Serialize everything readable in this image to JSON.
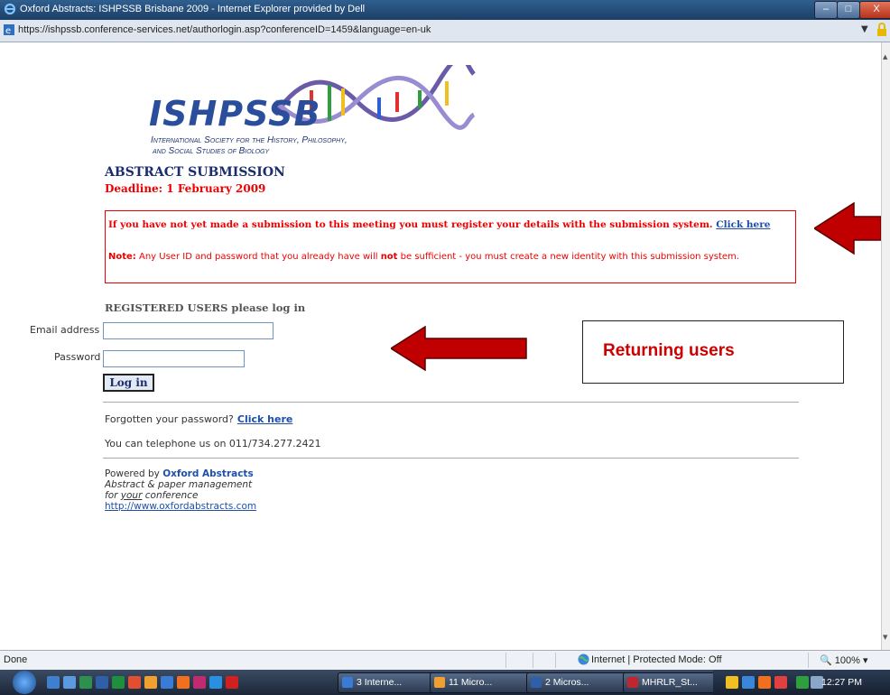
{
  "window": {
    "title": "Oxford Abstracts: ISHPSSB Brisbane 2009 - Internet Explorer provided by Dell",
    "minimize": "–",
    "maximize": "□",
    "close": "X"
  },
  "address_bar": {
    "url": "https://ishpssb.conference-services.net/authorlogin.asp?conferenceID=1459&language=en-uk",
    "dropdown": "▼"
  },
  "page": {
    "logo_text": "ISHPSSB",
    "logo_subtitle_line1": "International Society for the History, Philosophy,",
    "logo_subtitle_line2": "and Social Studies of Biology",
    "heading": "ABSTRACT SUBMISSION",
    "deadline": "Deadline: 1 February 2009",
    "notice": {
      "text": "If you have not yet made a submission to this meeting you must register your details with the submission system.",
      "link": "Click here",
      "note_label": "Note:",
      "note_pre": " Any User ID and password that you already have will ",
      "note_bold": "not",
      "note_post": " be sufficient - you must create a new identity with this submission system."
    },
    "login": {
      "heading": "REGISTERED USERS please log in",
      "email_label": "Email address",
      "email_value": "",
      "password_label": "Password",
      "password_value": "",
      "button": "Log in"
    },
    "forgot_text": "Forgotten your password?",
    "forgot_link": "Click here",
    "phone": "You can telephone us on 011/734.277.2421",
    "powered_by": "Powered by",
    "powered_brand": "Oxford Abstracts",
    "tagline1": "Abstract & paper management",
    "tagline2_pre": "for ",
    "tagline2_em": "your",
    "tagline2_post": " conference",
    "website": "http://www.oxfordabstracts.com"
  },
  "annotation": {
    "returning_label": "Returning users",
    "arrow_color": "#c00000"
  },
  "status_bar": {
    "status": "Done",
    "zone": "Internet | Protected Mode: Off",
    "zoom": "100%"
  },
  "taskbar": {
    "tasks": [
      {
        "label": "3 Interne...",
        "color": "#3a7bd5"
      },
      {
        "label": "11 Micro...",
        "color": "#f0a030"
      },
      {
        "label": "2 Micros...",
        "color": "#2f5fa8"
      },
      {
        "label": "MHRLR_St...",
        "color": "#c0262d"
      }
    ],
    "clock": "12:27 PM"
  }
}
